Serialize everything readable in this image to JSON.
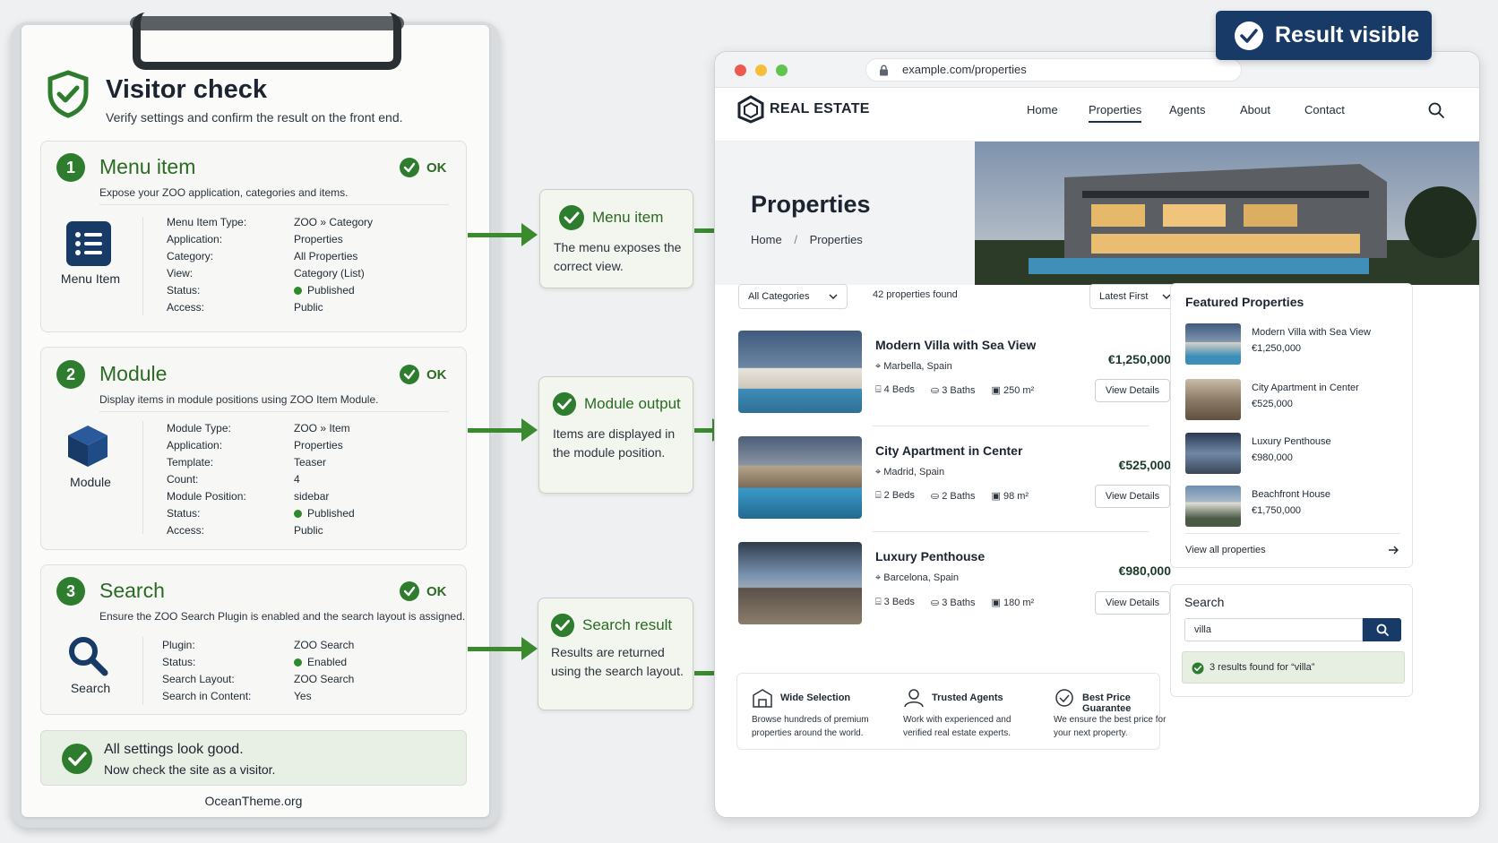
{
  "checklist": {
    "title": "Visitor check",
    "subtitle": "Verify settings and confirm the result on the front end.",
    "ok_label": "OK",
    "sections": [
      {
        "number": "1",
        "title": "Menu item",
        "description": "Expose your ZOO application, categories and items.",
        "icon_label": "Menu Item",
        "rows": [
          {
            "k": "Menu Item Type:",
            "v": "ZOO » Category"
          },
          {
            "k": "Application:",
            "v": "Properties"
          },
          {
            "k": "Category:",
            "v": "All Properties"
          },
          {
            "k": "View:",
            "v": "Category (List)"
          },
          {
            "k": "Status:",
            "v": "Published"
          },
          {
            "k": "Access:",
            "v": "Public"
          }
        ]
      },
      {
        "number": "2",
        "title": "Module",
        "description": "Display items in module positions using ZOO Item Module.",
        "icon_label": "Module",
        "rows": [
          {
            "k": "Module Type:",
            "v": "ZOO » Item"
          },
          {
            "k": "Application:",
            "v": "Properties"
          },
          {
            "k": "Template:",
            "v": "Teaser"
          },
          {
            "k": "Count:",
            "v": "4"
          },
          {
            "k": "Module Position:",
            "v": "sidebar"
          },
          {
            "k": "Status:",
            "v": "Published"
          },
          {
            "k": "Access:",
            "v": "Public"
          }
        ]
      },
      {
        "number": "3",
        "title": "Search",
        "description": "Ensure the ZOO Search Plugin is enabled and the search layout is assigned.",
        "icon_label": "Search",
        "rows": [
          {
            "k": "Plugin:",
            "v": "ZOO Search"
          },
          {
            "k": "Status:",
            "v": "Enabled"
          },
          {
            "k": "Search Layout:",
            "v": "ZOO Search"
          },
          {
            "k": "Search in Content:",
            "v": "Yes"
          }
        ]
      }
    ],
    "summary_title": "All settings look good.",
    "summary_body": "Now check the site as a visitor.",
    "footer": "OceanTheme.org"
  },
  "callouts": [
    {
      "title": "Menu item",
      "body": "The menu exposes the correct view."
    },
    {
      "title": "Module output",
      "body": "Items are displayed in the module position."
    },
    {
      "title": "Search result",
      "body": "Results are returned using the search layout."
    }
  ],
  "badge": {
    "label": "Result visible"
  },
  "browser": {
    "url": "example.com/properties",
    "logo": "REAL ESTATE",
    "nav": [
      "Home",
      "Properties",
      "Agents",
      "About",
      "Contact"
    ],
    "hero_title": "Properties",
    "breadcrumb_home": "Home",
    "breadcrumb_sep": "/",
    "breadcrumb_current": "Properties",
    "filter_category": "All Categories",
    "results_count": "42 properties found",
    "sort": "Latest First",
    "view_details": "View Details",
    "listings": [
      {
        "title": "Modern Villa with Sea View",
        "location": "Marbella, Spain",
        "beds": "4 Beds",
        "baths": "3 Baths",
        "area": "250 m²",
        "price": "€1,250,000"
      },
      {
        "title": "City Apartment in Center",
        "location": "Madrid, Spain",
        "beds": "2 Beds",
        "baths": "2 Baths",
        "area": "98 m²",
        "price": "€525,000"
      },
      {
        "title": "Luxury Penthouse",
        "location": "Barcelona, Spain",
        "beds": "3 Beds",
        "baths": "3 Baths",
        "area": "180 m²",
        "price": "€980,000"
      }
    ],
    "featured_title": "Featured Properties",
    "featured": [
      {
        "title": "Modern Villa with Sea View",
        "price": "€1,250,000"
      },
      {
        "title": "City Apartment in Center",
        "price": "€525,000"
      },
      {
        "title": "Luxury Penthouse",
        "price": "€980,000"
      },
      {
        "title": "Beachfront House",
        "price": "€1,750,000"
      }
    ],
    "view_all": "View all properties",
    "search_title": "Search",
    "search_value": "villa",
    "search_result": "3 results found for “villa”",
    "features": [
      {
        "title": "Wide Selection",
        "body": "Browse hundreds of premium properties around the world."
      },
      {
        "title": "Trusted Agents",
        "body": "Work with experienced and verified real estate experts."
      },
      {
        "title": "Best Price Guarantee",
        "body": "We ensure the best price for your next property."
      }
    ]
  },
  "colors": {
    "accent_green": "#2e7d2e",
    "badge_navy": "#173a66",
    "search_button": "#173a66"
  }
}
